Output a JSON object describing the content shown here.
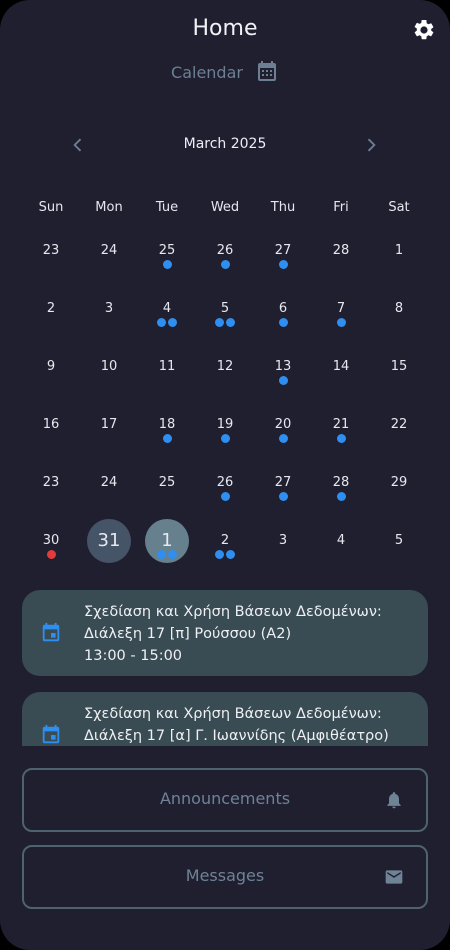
{
  "header": {
    "title": "Home",
    "settings_icon": "gear-icon"
  },
  "calendar_link": {
    "label": "Calendar",
    "icon": "calendar-icon"
  },
  "calendar": {
    "month_label": "March 2025",
    "weekdays": [
      "Sun",
      "Mon",
      "Tue",
      "Wed",
      "Thu",
      "Fri",
      "Sat"
    ],
    "weeks": [
      [
        {
          "d": "23",
          "dots": 0
        },
        {
          "d": "24",
          "dots": 0
        },
        {
          "d": "25",
          "dots": 1
        },
        {
          "d": "26",
          "dots": 1
        },
        {
          "d": "27",
          "dots": 1
        },
        {
          "d": "28",
          "dots": 0
        },
        {
          "d": "1",
          "dots": 0
        }
      ],
      [
        {
          "d": "2",
          "dots": 0
        },
        {
          "d": "3",
          "dots": 0
        },
        {
          "d": "4",
          "dots": 2
        },
        {
          "d": "5",
          "dots": 2
        },
        {
          "d": "6",
          "dots": 1
        },
        {
          "d": "7",
          "dots": 1
        },
        {
          "d": "8",
          "dots": 0
        }
      ],
      [
        {
          "d": "9",
          "dots": 0
        },
        {
          "d": "10",
          "dots": 0
        },
        {
          "d": "11",
          "dots": 0
        },
        {
          "d": "12",
          "dots": 0
        },
        {
          "d": "13",
          "dots": 1
        },
        {
          "d": "14",
          "dots": 0
        },
        {
          "d": "15",
          "dots": 0
        }
      ],
      [
        {
          "d": "16",
          "dots": 0
        },
        {
          "d": "17",
          "dots": 0
        },
        {
          "d": "18",
          "dots": 1
        },
        {
          "d": "19",
          "dots": 1
        },
        {
          "d": "20",
          "dots": 1
        },
        {
          "d": "21",
          "dots": 1
        },
        {
          "d": "22",
          "dots": 0
        }
      ],
      [
        {
          "d": "23",
          "dots": 0
        },
        {
          "d": "24",
          "dots": 0
        },
        {
          "d": "25",
          "dots": 0
        },
        {
          "d": "26",
          "dots": 1
        },
        {
          "d": "27",
          "dots": 1
        },
        {
          "d": "28",
          "dots": 1
        },
        {
          "d": "29",
          "dots": 0
        }
      ],
      [
        {
          "d": "30",
          "dots": 0,
          "red": true
        },
        {
          "d": "31",
          "dots": 0,
          "state": "today"
        },
        {
          "d": "1",
          "dots": 2,
          "state": "selected"
        },
        {
          "d": "2",
          "dots": 2
        },
        {
          "d": "3",
          "dots": 0
        },
        {
          "d": "4",
          "dots": 0
        },
        {
          "d": "5",
          "dots": 0
        }
      ]
    ]
  },
  "events": [
    {
      "title": "Σχεδίαση και Χρήση Βάσεων Δεδομένων:",
      "subtitle": "Διάλεξη 17 [π] Ρούσσου (Α2)",
      "time": "13:00 - 15:00"
    },
    {
      "title": "Σχεδίαση και Χρήση Βάσεων Δεδομένων:",
      "subtitle": "Διάλεξη 17 [α] Γ. Ιωαννίδης (Αμφιθέατρο)",
      "time": ""
    }
  ],
  "buttons": {
    "announcements": {
      "label": "Announcements",
      "icon": "bell-icon"
    },
    "messages": {
      "label": "Messages",
      "icon": "mail-icon"
    }
  },
  "colors": {
    "background": "#1f1f30",
    "event_card": "#394b53",
    "dot": "#2e8ff0",
    "dot_red": "#e53a3a",
    "today": "#465467",
    "selected": "#66808d"
  }
}
